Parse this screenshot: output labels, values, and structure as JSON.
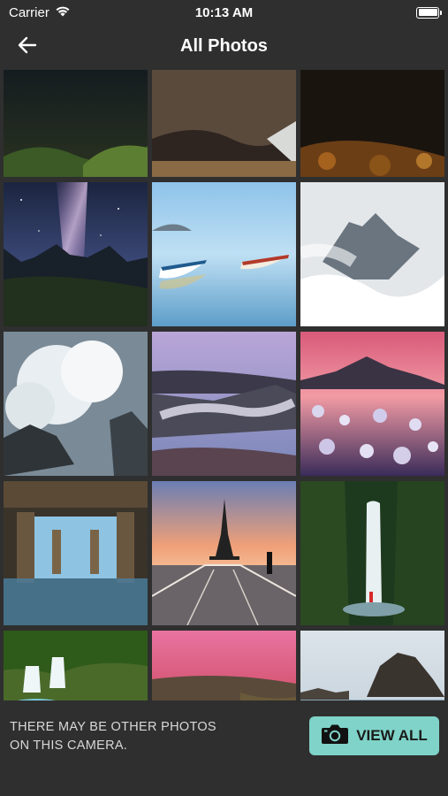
{
  "status": {
    "carrier": "Carrier",
    "time": "10:13 AM",
    "battery_level": 1.0
  },
  "nav": {
    "title": "All Photos",
    "back_icon": "arrow-left-icon"
  },
  "photos": [
    {
      "name": "photo-partial-1",
      "theme": "night-grass"
    },
    {
      "name": "photo-partial-2",
      "theme": "rocky-shore"
    },
    {
      "name": "photo-partial-3",
      "theme": "autumn-dark"
    },
    {
      "name": "photo-milky-way",
      "theme": "milky-way"
    },
    {
      "name": "photo-boats",
      "theme": "boats"
    },
    {
      "name": "photo-misty-peak",
      "theme": "misty-peak"
    },
    {
      "name": "photo-wave",
      "theme": "wave"
    },
    {
      "name": "photo-coast-cascade",
      "theme": "coast-cascade"
    },
    {
      "name": "photo-frozen-lake",
      "theme": "frozen-lake"
    },
    {
      "name": "photo-pier",
      "theme": "pier"
    },
    {
      "name": "photo-eiffel",
      "theme": "eiffel"
    },
    {
      "name": "photo-waterfall",
      "theme": "waterfall"
    },
    {
      "name": "photo-falls",
      "theme": "falls"
    },
    {
      "name": "photo-canyon",
      "theme": "canyon"
    },
    {
      "name": "photo-sea-stack",
      "theme": "sea-stack"
    }
  ],
  "footer": {
    "note": "THERE MAY BE OTHER PHOTOS ON THIS CAMERA.",
    "view_all_label": "VIEW ALL",
    "button_color": "#7fd3c8",
    "camera_icon": "camera-icon"
  }
}
